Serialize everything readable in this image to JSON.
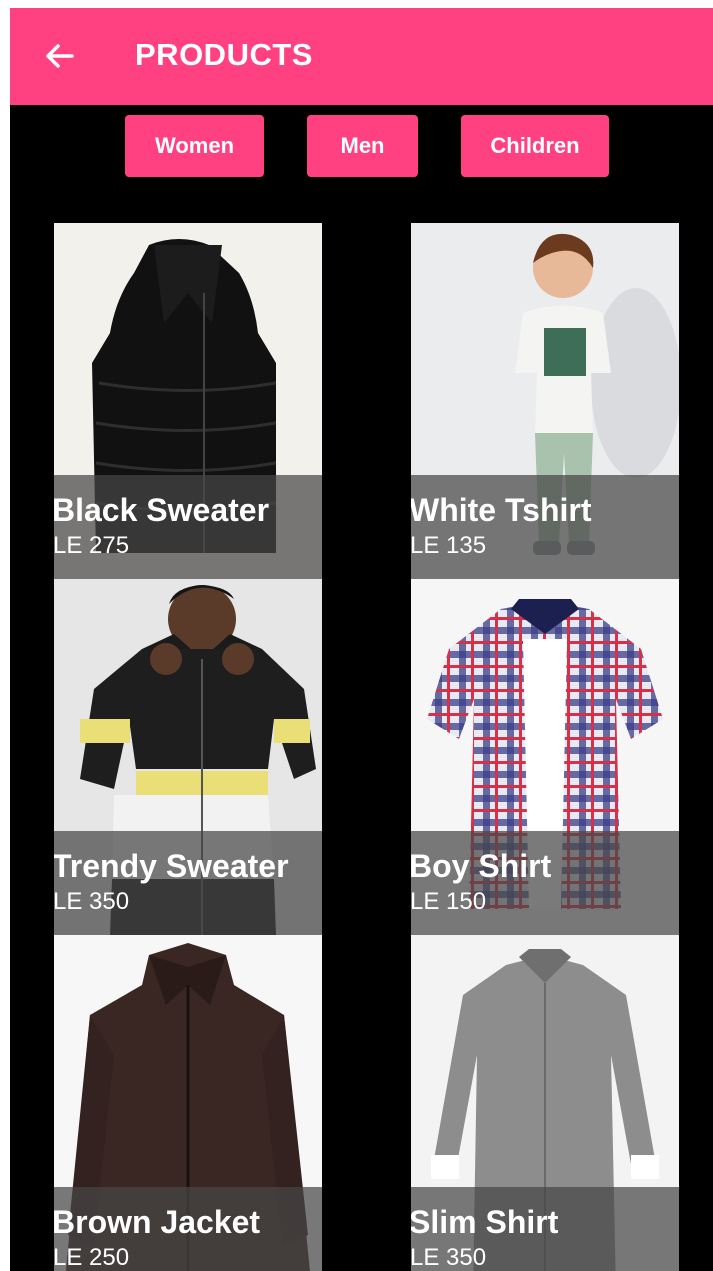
{
  "header": {
    "title": "PRODUCTS",
    "back_icon": "arrow-left-icon",
    "color": "#ff4081"
  },
  "categories": [
    "Women",
    "Men",
    "Children"
  ],
  "products": [
    {
      "name": "Black Sweater",
      "price": "LE 275",
      "image": "black puffer vest"
    },
    {
      "name": "White Tshirt",
      "price": "LE 135",
      "image": "boy in white t-shirt"
    },
    {
      "name": "Trendy Sweater",
      "price": "LE 350",
      "image": "man in color-block windbreaker"
    },
    {
      "name": "Boy Shirt",
      "price": "LE 150",
      "image": "plaid short-sleeve shirt"
    },
    {
      "name": "Brown Jacket",
      "price": "LE 250",
      "image": "brown zip jacket"
    },
    {
      "name": "Slim Shirt",
      "price": "LE 350",
      "image": "grey long-sleeve shirt"
    }
  ]
}
